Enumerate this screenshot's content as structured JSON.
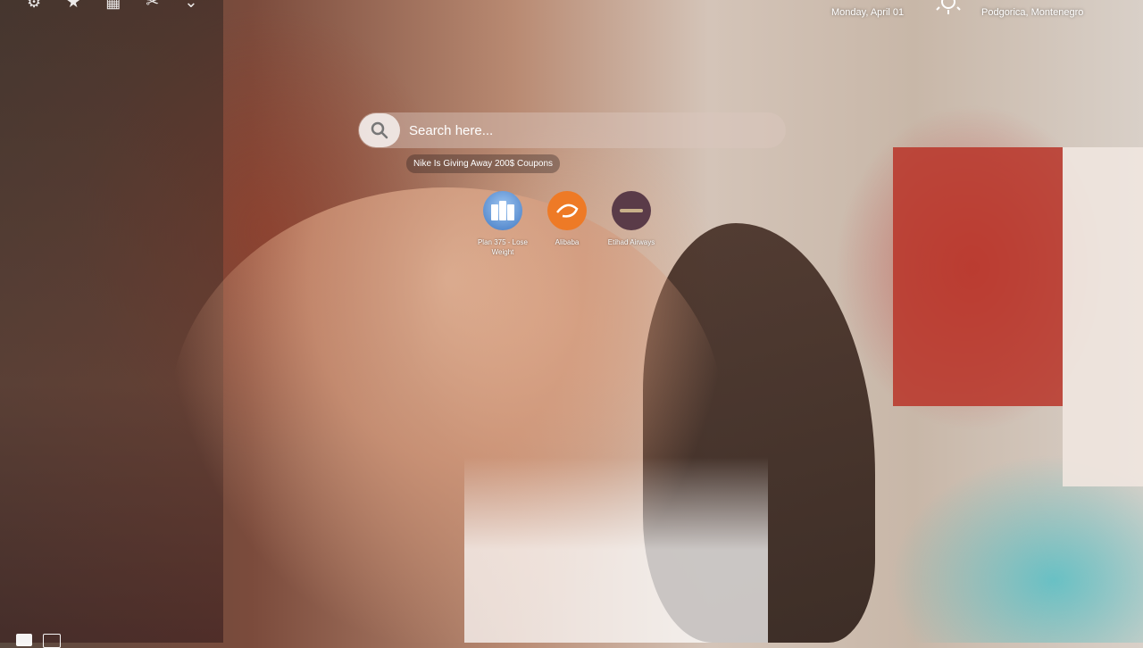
{
  "topbar": {
    "icons": [
      "settings-icon",
      "star-icon",
      "grid-icon",
      "tools-icon",
      "chevron-icon"
    ],
    "date": "Monday, April 01",
    "weather_icon": "sun-icon",
    "location": "Podgorica, Montenegro"
  },
  "search": {
    "placeholder": "Search here...",
    "promo": "Nike Is Giving Away 200$ Coupons"
  },
  "shortcuts": [
    {
      "label": "Plan 375 - Lose Weight",
      "icon": "diet-plan-icon",
      "color": "#3f78c4"
    },
    {
      "label": "Alibaba",
      "icon": "alibaba-logo-icon",
      "color": "#ee7a26"
    },
    {
      "label": "Etihad Airways",
      "icon": "etihad-logo-icon",
      "color": "#5a3b48"
    }
  ],
  "bottom": {
    "icons": [
      "window-icon",
      "list-icon"
    ]
  }
}
